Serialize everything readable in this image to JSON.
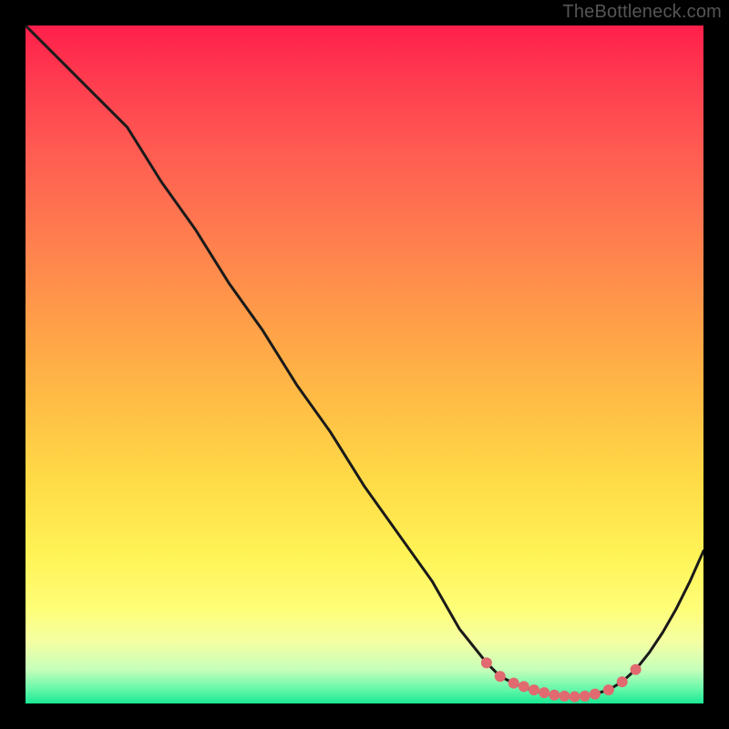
{
  "watermark": "TheBottleneck.com",
  "colors": {
    "page_bg": "#000000",
    "curve_stroke": "#1a1a1a",
    "marker_fill": "#e06a6f",
    "gradient_stops": [
      "#ff1f4b",
      "#ff3b4f",
      "#ff5a52",
      "#ff7a4f",
      "#ff9a49",
      "#ffb945",
      "#ffd846",
      "#fff356",
      "#fffe78",
      "#f4ffa4",
      "#c6ffba",
      "#62f7a9",
      "#19e892"
    ]
  },
  "chart_data": {
    "type": "line",
    "title": "",
    "xlabel": "",
    "ylabel": "",
    "xlim": [
      0,
      100
    ],
    "ylim": [
      0,
      100
    ],
    "grid": false,
    "legend": false,
    "series": [
      {
        "name": "curve",
        "x": [
          0,
          5,
          10,
          15,
          20,
          25,
          30,
          35,
          40,
          45,
          50,
          55,
          60,
          64,
          68,
          70,
          72,
          74,
          76,
          78,
          80,
          82,
          84,
          86,
          88,
          90,
          92,
          94,
          96,
          98,
          100
        ],
        "y": [
          100,
          95,
          90,
          85,
          77,
          70,
          62,
          55,
          47,
          40,
          32,
          25,
          18,
          11,
          6,
          4,
          3,
          2.2,
          1.6,
          1.2,
          1.0,
          1.1,
          1.4,
          2.0,
          3.2,
          5.0,
          7.5,
          10.5,
          14.0,
          18.0,
          22.5
        ]
      }
    ],
    "markers": {
      "x": [
        68,
        70,
        72,
        73.5,
        75,
        76.5,
        78,
        79.5,
        81,
        82.5,
        84,
        86,
        88,
        90
      ],
      "y": [
        6.0,
        4.0,
        3.0,
        2.5,
        2.0,
        1.6,
        1.25,
        1.1,
        1.0,
        1.1,
        1.4,
        2.0,
        3.2,
        5.0
      ]
    }
  }
}
